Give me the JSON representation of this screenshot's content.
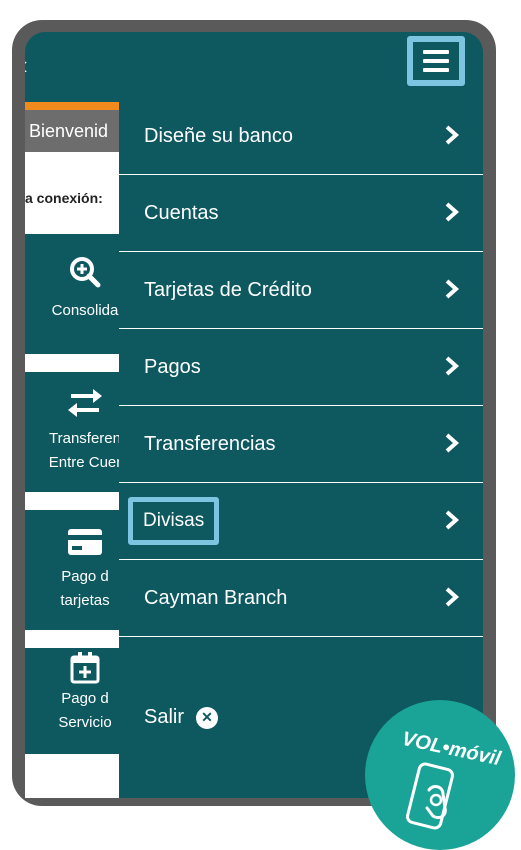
{
  "header": {
    "back_icon": "chevron-left-icon",
    "menu_icon": "hamburger-icon"
  },
  "background": {
    "welcome_text": "Bienvenid",
    "connection_text": "a conexión:",
    "tiles": [
      {
        "icon": "zoom-in-icon",
        "line1": "Consolida",
        "line2": ""
      },
      {
        "icon": "transfer-arrows-icon",
        "line1": "Transferen",
        "line2": "Entre Cuer"
      },
      {
        "icon": "credit-card-icon",
        "line1": "Pago d",
        "line2": "tarjetas"
      },
      {
        "icon": "calendar-plus-icon",
        "line1": "Pago d",
        "line2": "Servicio"
      }
    ]
  },
  "menu": {
    "items": [
      {
        "label": "Diseñe su banco"
      },
      {
        "label": "Cuentas"
      },
      {
        "label": "Tarjetas de Crédito"
      },
      {
        "label": "Pagos"
      },
      {
        "label": "Transferencias"
      },
      {
        "label": "Divisas"
      },
      {
        "label": "Cayman Branch"
      }
    ],
    "logout_label": "Salir",
    "logout_icon": "close-circle-icon"
  },
  "badge": {
    "text": "VOL•móvil",
    "icon": "phone-touch-icon"
  },
  "colors": {
    "primary": "#0e5960",
    "highlight": "#7cc4e0",
    "accent": "#f08a1c",
    "badge": "#1aa397",
    "frame": "#5a5a5a"
  }
}
